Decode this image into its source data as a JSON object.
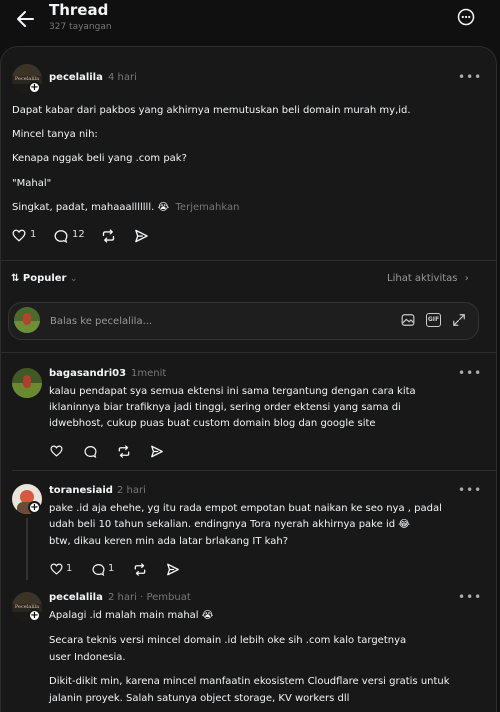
{
  "header": {
    "title": "Thread",
    "views": "327 tayangan"
  },
  "post": {
    "username": "pecelalila",
    "time": "4 hari",
    "avatar_text": "Pecelalila",
    "lines": [
      "Dapat kabar dari pakbos yang akhirnya memutuskan beli domain murah my,id.",
      "Mincel tanya nih:",
      "Kenapa nggak beli yang .com pak?",
      "\"Mahal\"",
      "Singkat, padat, mahaaalllllll. 😭"
    ],
    "translate": "Terjemahkan",
    "likes": "1",
    "replies": "12"
  },
  "sort": {
    "label": "Populer",
    "activity": "Lihat aktivitas"
  },
  "reply_box": {
    "placeholder": "Balas ke pecelalila..."
  },
  "replies": [
    {
      "username": "bagasandri03",
      "time": "1menit",
      "lines": [
        "kalau pendapat sya semua ektensi ini sama tergantung dengan cara kita",
        "iklaninnya biar trafiknya jadi tinggi, sering order ektensi yang sama di",
        "idwebhost, cukup puas buat custom domain blog dan google site"
      ]
    },
    {
      "username": "toranesiaid",
      "time": "2 hari",
      "lines": [
        "pake .id aja ehehe, yg itu rada empot empotan buat naikan ke seo nya , padal",
        "udah beli 10 tahun sekalian. endingnya Tora nyerah akhirnya pake id 😂",
        "btw, dikau keren min ada latar brlakang IT kah?"
      ],
      "likes": "1",
      "replies": "1"
    },
    {
      "username": "pecelalila",
      "time": "2 hari",
      "author_tag": "Pembuat",
      "lines": [
        "Apalagi .id malah main mahal 😭",
        "Secara teknis versi mincel domain .id lebih oke sih .com kalo targetnya",
        "user Indonesia.",
        "Dikit-dikit min, karena mincel manfaatin ekosistem Cloudflare versi gratis untuk",
        "jalanin proyek. Salah satunya object storage, KV workers dll"
      ]
    }
  ],
  "colors": {
    "background": "#101010",
    "panel": "#181818",
    "text": "#f3f5f7",
    "muted": "#777777"
  }
}
